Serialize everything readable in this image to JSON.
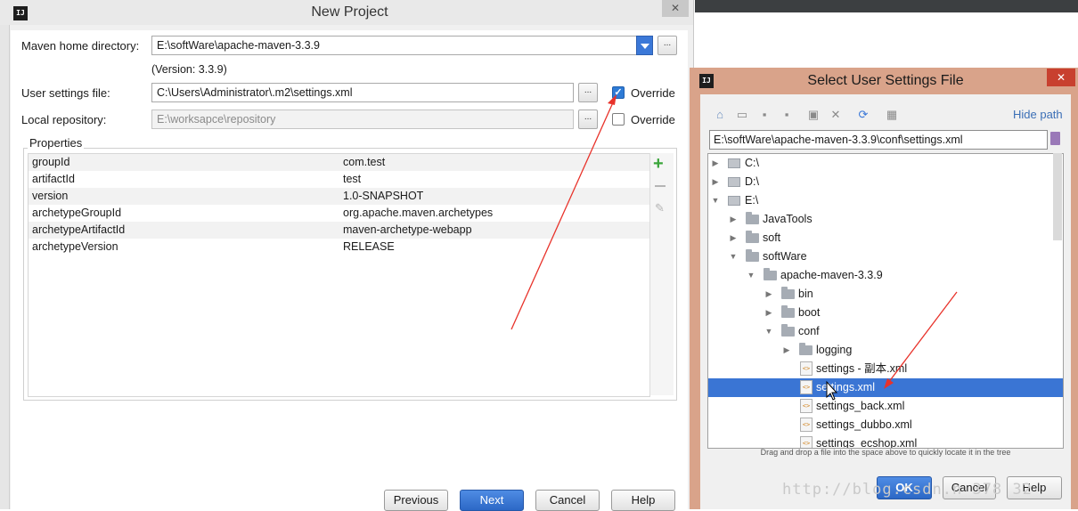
{
  "new_project": {
    "title": "New Project",
    "maven_home": {
      "label": "Maven home directory:",
      "value": "E:\\softWare\\apache-maven-3.3.9",
      "version": "(Version: 3.3.9)"
    },
    "user_settings": {
      "label": "User settings file:",
      "value": "C:\\Users\\Administrator\\.m2\\settings.xml",
      "override_label": "Override",
      "override_checked": true
    },
    "local_repo": {
      "label": "Local repository:",
      "value": "E:\\worksapce\\repository",
      "override_label": "Override",
      "override_checked": false
    },
    "properties": {
      "title": "Properties",
      "rows": [
        {
          "key": "groupId",
          "value": "com.test"
        },
        {
          "key": "artifactId",
          "value": "test"
        },
        {
          "key": "version",
          "value": "1.0-SNAPSHOT"
        },
        {
          "key": "archetypeGroupId",
          "value": "org.apache.maven.archetypes"
        },
        {
          "key": "archetypeArtifactId",
          "value": "maven-archetype-webapp"
        },
        {
          "key": "archetypeVersion",
          "value": "RELEASE"
        }
      ]
    },
    "buttons": {
      "previous": "Previous",
      "next": "Next",
      "cancel": "Cancel",
      "help": "Help"
    },
    "browse_label": "...",
    "close_glyph": "✕"
  },
  "select_dialog": {
    "title": "Select User Settings File",
    "hide_path": "Hide path",
    "path_value": "E:\\softWare\\apache-maven-3.3.9\\conf\\settings.xml",
    "tree": [
      {
        "label": "C:\\",
        "kind": "drive",
        "expanded": false
      },
      {
        "label": "D:\\",
        "kind": "drive",
        "expanded": false
      },
      {
        "label": "E:\\",
        "kind": "drive",
        "expanded": true
      },
      {
        "label": "JavaTools",
        "kind": "folder",
        "expanded": false
      },
      {
        "label": "soft",
        "kind": "folder",
        "expanded": false
      },
      {
        "label": "softWare",
        "kind": "folder",
        "expanded": true
      },
      {
        "label": "apache-maven-3.3.9",
        "kind": "folder",
        "expanded": true
      },
      {
        "label": "bin",
        "kind": "folder",
        "expanded": false
      },
      {
        "label": "boot",
        "kind": "folder",
        "expanded": false
      },
      {
        "label": "conf",
        "kind": "folder",
        "expanded": true
      },
      {
        "label": "logging",
        "kind": "folder",
        "expanded": false
      },
      {
        "label": "settings - 副本.xml",
        "kind": "xml"
      },
      {
        "label": "settings.xml",
        "kind": "xml",
        "selected": true
      },
      {
        "label": "settings_back.xml",
        "kind": "xml"
      },
      {
        "label": "settings_dubbo.xml",
        "kind": "xml"
      },
      {
        "label": "settings_ecshop.xml",
        "kind": "xml"
      }
    ],
    "hint": "Drag and drop a file into the space above to quickly locate it in the tree",
    "buttons": {
      "ok": "OK",
      "cancel": "Cancel",
      "help": "Help"
    },
    "close_glyph": "✕"
  },
  "watermark": "http://blog.csdn.n         378  32",
  "colors": {
    "accent": "#3b78d8",
    "selection": "#3a75d4",
    "dialog_frame": "#d9a38a",
    "close_red": "#c8402f",
    "annotation_arrow": "#e8322a"
  }
}
